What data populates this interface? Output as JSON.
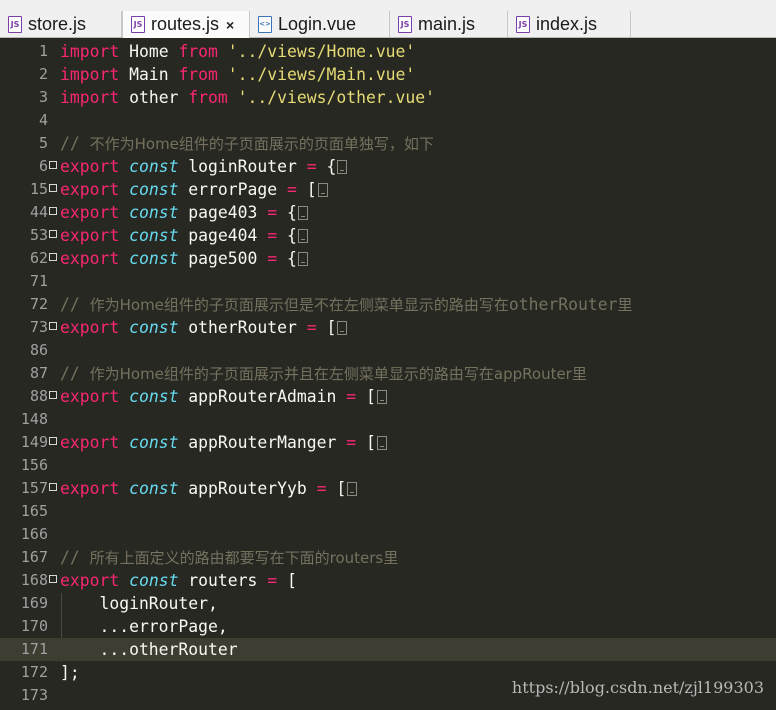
{
  "tabs": [
    {
      "label": "store.js",
      "icon": "js-file-icon",
      "active": false
    },
    {
      "label": "routes.js",
      "icon": "js-file-icon",
      "active": true,
      "close": "×"
    },
    {
      "label": "Login.vue",
      "icon": "vue-file-icon",
      "active": false
    },
    {
      "label": "main.js",
      "icon": "js-file-icon",
      "active": false
    },
    {
      "label": "index.js",
      "icon": "js-file-icon",
      "active": false
    }
  ],
  "icon_text": {
    "js": "JS",
    "vue": "<>"
  },
  "theme": {
    "background": "#272822",
    "keyword": "#f92672",
    "storage": "#66d9ef",
    "string": "#e6db74",
    "comment": "#75715e",
    "text": "#f8f8f2"
  },
  "lines": [
    {
      "n": "1",
      "parts": [
        [
          "kw",
          "import"
        ],
        [
          "pl",
          " Home "
        ],
        [
          "kw",
          "from"
        ],
        [
          "pl",
          " "
        ],
        [
          "str",
          "'../views/Home.vue'"
        ]
      ]
    },
    {
      "n": "2",
      "parts": [
        [
          "kw",
          "import"
        ],
        [
          "pl",
          " Main "
        ],
        [
          "kw",
          "from"
        ],
        [
          "pl",
          " "
        ],
        [
          "str",
          "'../views/Main.vue'"
        ]
      ]
    },
    {
      "n": "3",
      "parts": [
        [
          "kw",
          "import"
        ],
        [
          "pl",
          " other "
        ],
        [
          "kw",
          "from"
        ],
        [
          "pl",
          " "
        ],
        [
          "str",
          "'../views/other.vue'"
        ]
      ]
    },
    {
      "n": "4",
      "parts": []
    },
    {
      "n": "5",
      "parts": [
        [
          "cm",
          "// "
        ],
        [
          "cmcjk",
          "不作为Home组件的子页面展示的页面单独写，如下"
        ]
      ]
    },
    {
      "n": "6",
      "fold": true,
      "collapsed": true,
      "parts": [
        [
          "kw",
          "export"
        ],
        [
          "pl",
          " "
        ],
        [
          "st",
          "const"
        ],
        [
          "pl",
          " loginRouter "
        ],
        [
          "kw",
          "="
        ],
        [
          "pl",
          " {"
        ]
      ]
    },
    {
      "n": "15",
      "fold": true,
      "collapsed": true,
      "parts": [
        [
          "kw",
          "export"
        ],
        [
          "pl",
          " "
        ],
        [
          "st",
          "const"
        ],
        [
          "pl",
          " errorPage "
        ],
        [
          "kw",
          "="
        ],
        [
          "pl",
          " ["
        ]
      ]
    },
    {
      "n": "44",
      "fold": true,
      "collapsed": true,
      "parts": [
        [
          "kw",
          "export"
        ],
        [
          "pl",
          " "
        ],
        [
          "st",
          "const"
        ],
        [
          "pl",
          " page403 "
        ],
        [
          "kw",
          "="
        ],
        [
          "pl",
          " {"
        ]
      ]
    },
    {
      "n": "53",
      "fold": true,
      "collapsed": true,
      "parts": [
        [
          "kw",
          "export"
        ],
        [
          "pl",
          " "
        ],
        [
          "st",
          "const"
        ],
        [
          "pl",
          " page404 "
        ],
        [
          "kw",
          "="
        ],
        [
          "pl",
          " {"
        ]
      ]
    },
    {
      "n": "62",
      "fold": true,
      "collapsed": true,
      "parts": [
        [
          "kw",
          "export"
        ],
        [
          "pl",
          " "
        ],
        [
          "st",
          "const"
        ],
        [
          "pl",
          " page500 "
        ],
        [
          "kw",
          "="
        ],
        [
          "pl",
          " {"
        ]
      ]
    },
    {
      "n": "71",
      "parts": []
    },
    {
      "n": "72",
      "parts": [
        [
          "cm",
          "// "
        ],
        [
          "cmcjk",
          "作为Home组件的子页面展示但是不在左侧菜单显示的路由写在"
        ],
        [
          "cm",
          "otherRouter"
        ],
        [
          "cmcjk",
          "里"
        ]
      ]
    },
    {
      "n": "73",
      "fold": true,
      "collapsed": true,
      "parts": [
        [
          "kw",
          "export"
        ],
        [
          "pl",
          " "
        ],
        [
          "st",
          "const"
        ],
        [
          "pl",
          " otherRouter "
        ],
        [
          "kw",
          "="
        ],
        [
          "pl",
          " ["
        ]
      ]
    },
    {
      "n": "86",
      "parts": []
    },
    {
      "n": "87",
      "parts": [
        [
          "cm",
          "// "
        ],
        [
          "cmcjk",
          "作为Home组件的子页面展示并且在左侧菜单显示的路由写在appRouter里"
        ]
      ]
    },
    {
      "n": "88",
      "fold": true,
      "collapsed": true,
      "parts": [
        [
          "kw",
          "export"
        ],
        [
          "pl",
          " "
        ],
        [
          "st",
          "const"
        ],
        [
          "pl",
          " appRouterAdmain "
        ],
        [
          "kw",
          "="
        ],
        [
          "pl",
          " ["
        ]
      ]
    },
    {
      "n": "148",
      "parts": []
    },
    {
      "n": "149",
      "fold": true,
      "collapsed": true,
      "parts": [
        [
          "kw",
          "export"
        ],
        [
          "pl",
          " "
        ],
        [
          "st",
          "const"
        ],
        [
          "pl",
          " appRouterManger "
        ],
        [
          "kw",
          "="
        ],
        [
          "pl",
          " ["
        ]
      ]
    },
    {
      "n": "156",
      "parts": []
    },
    {
      "n": "157",
      "fold": true,
      "collapsed": true,
      "parts": [
        [
          "kw",
          "export"
        ],
        [
          "pl",
          " "
        ],
        [
          "st",
          "const"
        ],
        [
          "pl",
          " appRouterYyb "
        ],
        [
          "kw",
          "="
        ],
        [
          "pl",
          " ["
        ]
      ]
    },
    {
      "n": "165",
      "parts": []
    },
    {
      "n": "166",
      "parts": []
    },
    {
      "n": "167",
      "parts": [
        [
          "cm",
          "// "
        ],
        [
          "cmcjk",
          "所有上面定义的路由都要写在下面的routers里"
        ]
      ]
    },
    {
      "n": "168",
      "fold": true,
      "parts": [
        [
          "kw",
          "export"
        ],
        [
          "pl",
          " "
        ],
        [
          "st",
          "const"
        ],
        [
          "pl",
          " routers "
        ],
        [
          "kw",
          "="
        ],
        [
          "pl",
          " ["
        ]
      ]
    },
    {
      "n": "169",
      "parts": [
        [
          "pl",
          "    loginRouter,"
        ]
      ]
    },
    {
      "n": "170",
      "parts": [
        [
          "pl",
          "    ...errorPage,"
        ]
      ]
    },
    {
      "n": "171",
      "current": true,
      "parts": [
        [
          "pl",
          "    ...otherRouter"
        ]
      ]
    },
    {
      "n": "172",
      "parts": [
        [
          "pl",
          "];"
        ]
      ]
    },
    {
      "n": "173",
      "parts": []
    }
  ],
  "watermark": "https://blog.csdn.net/zjl199303"
}
